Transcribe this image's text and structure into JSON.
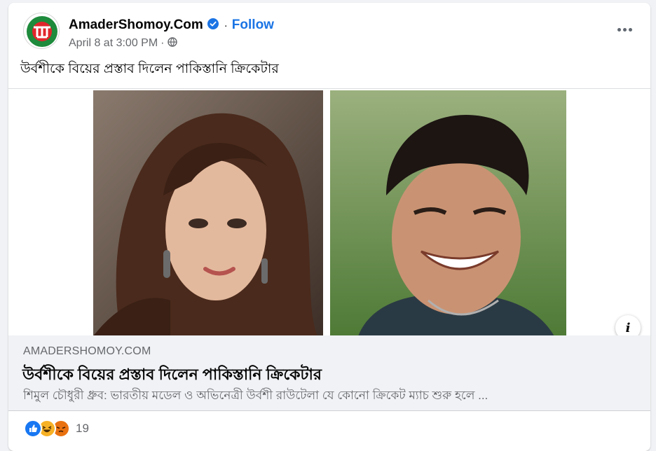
{
  "post": {
    "page_name": "AmaderShomoy.Com",
    "follow_label": "Follow",
    "timestamp": "April 8 at 3:00 PM",
    "separator": "·",
    "caption": "উর্বশীকে বিয়ের প্রস্তাব দিলেন পাকিস্তানি ক্রিকেটার"
  },
  "icons": {
    "avatar": "amadershomoy-logo",
    "verified": "verified-badge-icon",
    "privacy": "globe-icon",
    "more": "more-options-icon",
    "info": "info-icon"
  },
  "link_preview": {
    "domain": "AMADERSHOMOY.COM",
    "title": "উর্বশীকে বিয়ের প্রস্তাব দিলেন পাকিস্তানি ক্রিকেটার",
    "description": "শিমুল চৌধুরী ধ্রুব: ভারতীয় মডেল ও অভিনেত্রী উর্বশী রাউটেলা যে কোনো ক্রিকেট ম্যাচ শুরু হলে ..."
  },
  "reactions": {
    "types": [
      "like",
      "haha",
      "angry"
    ],
    "count": "19"
  },
  "colors": {
    "accent": "#1b74e4",
    "logo_green": "#1e8a3c",
    "logo_red": "#e0262b"
  }
}
